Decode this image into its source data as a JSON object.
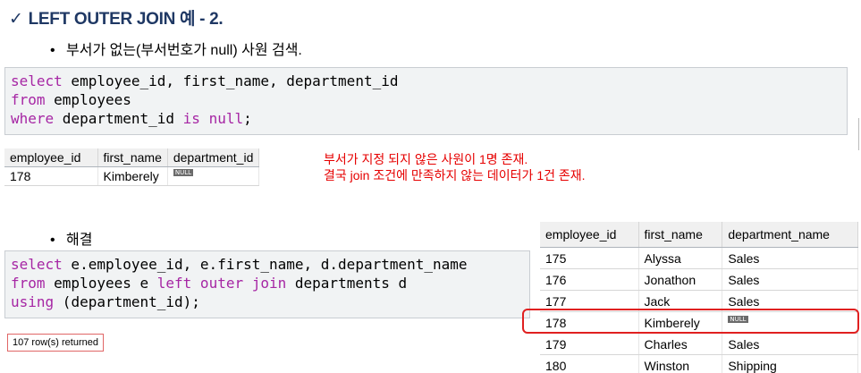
{
  "title": {
    "check_glyph": "✓",
    "text": "LEFT OUTER JOIN 예 - 2."
  },
  "bullet1": {
    "dot": "•",
    "text": "부서가 없는(부서번호가 null) 사원 검색."
  },
  "query1": {
    "line1": {
      "kw": "select",
      "rest": " employee_id, first_name, department_id"
    },
    "line2": {
      "kw": "from",
      "rest": " employees"
    },
    "line3": {
      "kw": "where",
      "mid": " department_id ",
      "kw2": "is",
      "sp": " ",
      "kw3": "null",
      "end": ";"
    }
  },
  "result1": {
    "headers": [
      "employee_id",
      "first_name",
      "department_id"
    ],
    "row": {
      "employee_id": "178",
      "first_name": "Kimberely",
      "department_id": "NULL"
    }
  },
  "note": {
    "line1": "부서가 지정 되지 않은 사원이 1명 존재.",
    "line2": "결국 join 조건에 만족하지 않는 데이터가 1건 존재."
  },
  "bullet2": {
    "dot": "•",
    "text": "해결"
  },
  "query2": {
    "line1": {
      "kw": "select",
      "rest": " e.employee_id, e.first_name, d.department_name"
    },
    "line2": {
      "kw": "from",
      "mid": " employees e ",
      "kw2": "left outer join",
      "end": " departments d"
    },
    "line3": {
      "kw": "using",
      "rest": " (department_id);"
    }
  },
  "rows_returned": "107 row(s) returned",
  "result2": {
    "headers": [
      "employee_id",
      "first_name",
      "department_name"
    ],
    "rows": [
      {
        "employee_id": "175",
        "first_name": "Alyssa",
        "department_name": "Sales"
      },
      {
        "employee_id": "176",
        "first_name": "Jonathon",
        "department_name": "Sales"
      },
      {
        "employee_id": "177",
        "first_name": "Jack",
        "department_name": "Sales"
      },
      {
        "employee_id": "178",
        "first_name": "Kimberely",
        "department_name": "NULL"
      },
      {
        "employee_id": "179",
        "first_name": "Charles",
        "department_name": "Sales"
      },
      {
        "employee_id": "180",
        "first_name": "Winston",
        "department_name": "Shipping"
      }
    ],
    "highlighted_employee_id": "178"
  },
  "colors": {
    "title": "#1f3864",
    "keyword": "#a626a4",
    "note": "#e60000",
    "highlight": "#e02020"
  }
}
